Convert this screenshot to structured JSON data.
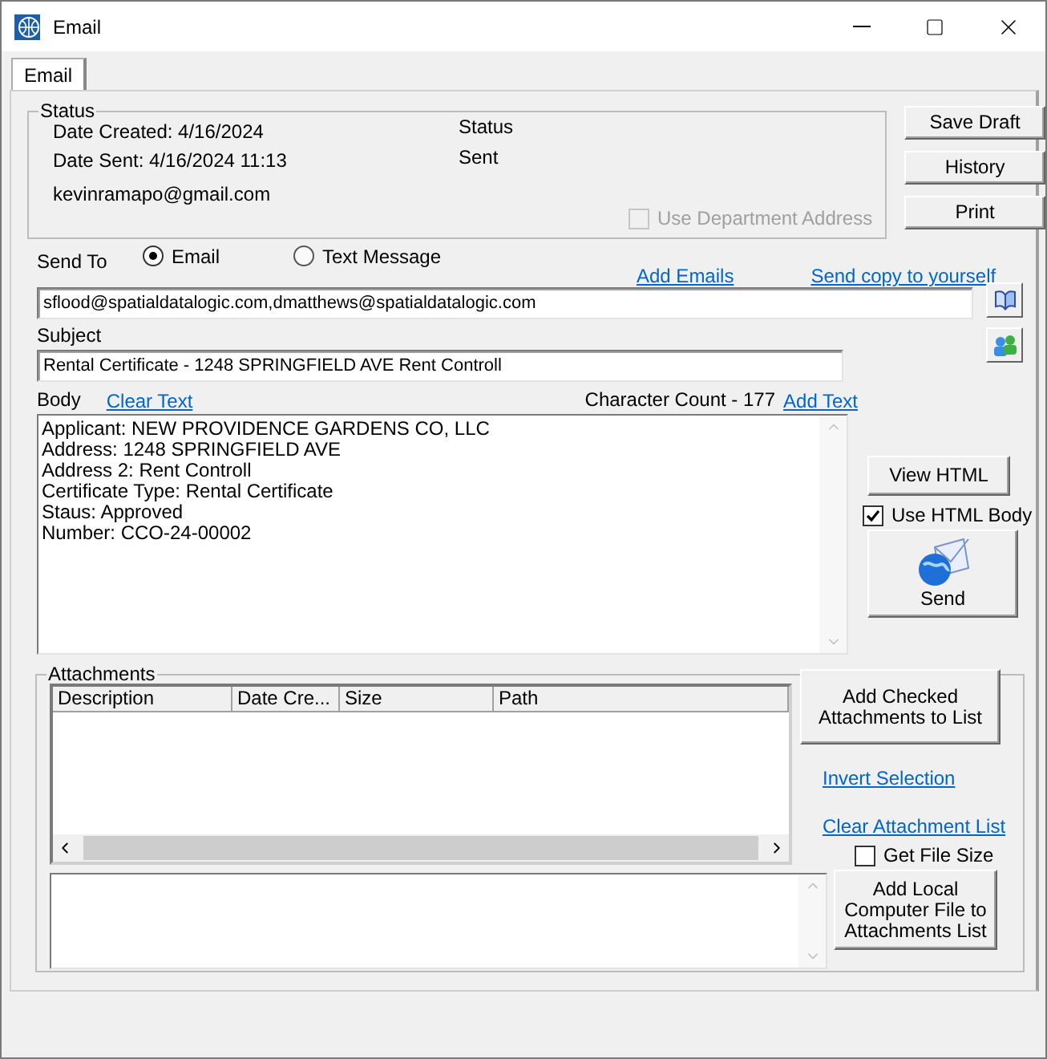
{
  "window": {
    "title": "Email"
  },
  "tabs": [
    {
      "label": "Email",
      "selected": true
    }
  ],
  "status_group": {
    "title": "Status",
    "date_created": "Date Created: 4/16/2024",
    "date_sent": "Date Sent: 4/16/2024 11:13",
    "from": "kevinramapo@gmail.com",
    "status_label": "Status",
    "status_value": "Sent",
    "use_department_address": {
      "label": "Use Department Address",
      "checked": false,
      "disabled": true
    }
  },
  "side_buttons": [
    "Save Draft",
    "History",
    "Print"
  ],
  "send_to": {
    "label": "Send To",
    "options": [
      {
        "label": "Email",
        "selected": true
      },
      {
        "label": "Text Message",
        "selected": false
      }
    ]
  },
  "links": [
    "Add Emails",
    "Send copy to yourself"
  ],
  "to_field": {
    "value": "sflood@spatialdatalogic.com,dmatthews@spatialdatalogic.com"
  },
  "subject": {
    "label": "Subject",
    "value": "Rental Certificate - 1248 SPRINGFIELD AVE Rent Controll"
  },
  "body": {
    "label": "Body",
    "clear_link": "Clear Text",
    "character_count": "Character Count - 177",
    "add_link": "Add Text",
    "lines": [
      "Applicant: NEW PROVIDENCE GARDENS CO, LLC",
      "Address: 1248 SPRINGFIELD AVE",
      "Address 2: Rent Controll",
      "Certificate Type: Rental Certificate",
      "Staus: Approved",
      "Number: CCO-24-00002"
    ]
  },
  "view_html_button": "View HTML",
  "use_html_body": {
    "label": "Use HTML Body",
    "checked": true
  },
  "send_button": "Send",
  "attachments": {
    "title": "Attachments",
    "columns": [
      "Description",
      "Date Cre...",
      "Size",
      "Path"
    ],
    "add_checked_button": "Add Checked Attachments to List",
    "invert_link": "Invert Selection",
    "clear_link": "Clear Attachment List",
    "get_file_size": {
      "label": "Get File Size",
      "checked": false
    },
    "add_local_button": "Add Local Computer File to Attachments List"
  }
}
